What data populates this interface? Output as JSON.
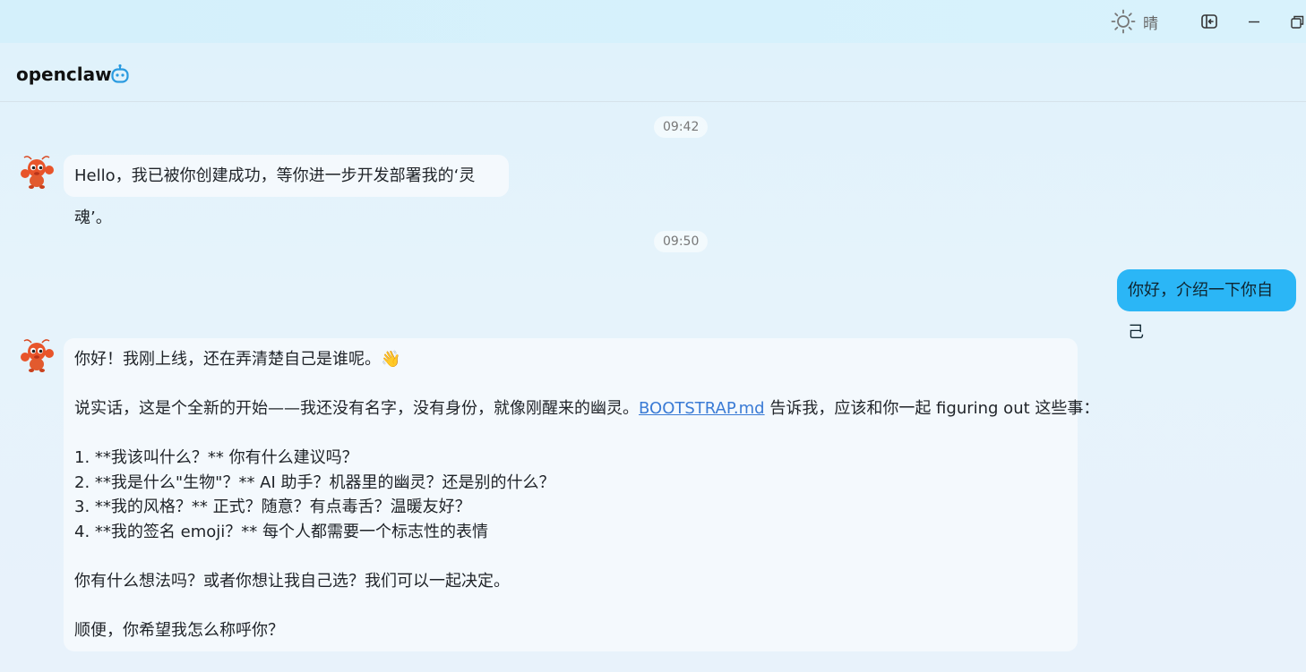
{
  "titlebar": {
    "weather_icon": "sun-icon",
    "weather_text": "晴",
    "buttons": [
      "dock-panel-icon",
      "minimize-icon",
      "restore-icon"
    ]
  },
  "header": {
    "title": "openclaw",
    "icon": "robot-icon",
    "accent_color": "#2b9be0"
  },
  "messages": {
    "ts1": "09:42",
    "bot1": "Hello，我已被你创建成功，等你进一步开发部署我的‘灵魂’。",
    "ts2": "09:50",
    "user1": "你好，介绍一下你自己",
    "bot2": {
      "l1": "你好！我刚上线，还在弄清楚自己是谁呢。👋",
      "l2_before": "说实话，这是个全新的开始——我还没有名字，没有身份，就像刚醒来的幽灵。",
      "l2_link": "BOOTSTRAP.md",
      "l2_after": " 告诉我，应该和你一起 figuring out 这些事：",
      "l3": "1. **我该叫什么？** 你有什么建议吗？",
      "l4": "2. **我是什么\"生物\"？** AI 助手？机器里的幽灵？还是别的什么？",
      "l5": "3. **我的风格？** 正式？随意？有点毒舌？温暖友好？",
      "l6": "4. **我的签名 emoji？** 每个人都需要一个标志性的表情",
      "l7": "你有什么想法吗？或者你想让我自己选？我们可以一起决定。",
      "l8": "顺便，你希望我怎么称呼你？"
    }
  },
  "colors": {
    "user_bubble": "#2bb6f6",
    "bot_bubble": "#f4f9fd",
    "link": "#3a7bd5"
  }
}
